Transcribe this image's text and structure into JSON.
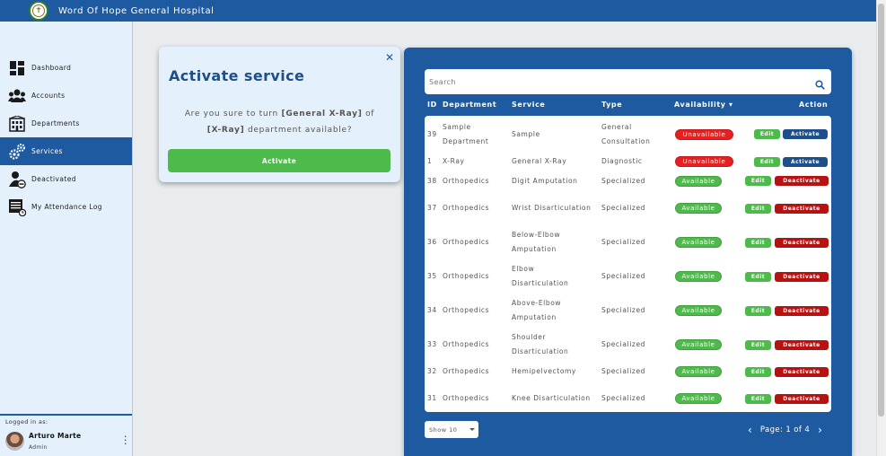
{
  "app": {
    "title": "Word Of Hope General Hospital"
  },
  "sidebar": {
    "items": [
      {
        "label": "Dashboard",
        "icon": "dashboard-icon"
      },
      {
        "label": "Accounts",
        "icon": "users-icon"
      },
      {
        "label": "Departments",
        "icon": "building-icon"
      },
      {
        "label": "Services",
        "icon": "gears-icon",
        "active": true
      },
      {
        "label": "Deactivated",
        "icon": "user-minus-icon"
      },
      {
        "label": "My Attendance Log",
        "icon": "log-icon"
      }
    ],
    "footer": {
      "logged_as": "Logged in as:",
      "name": "Arturo Marte",
      "role": "Admin"
    }
  },
  "modal": {
    "title": "Activate service",
    "msg_prefix": "Are you sure to turn ",
    "service": "[General X-Ray]",
    "msg_of": " of",
    "department": "[X-Ray]",
    "msg_suffix": " department available?",
    "button": "Activate"
  },
  "search": {
    "placeholder": "Search"
  },
  "table": {
    "headers": {
      "id": "ID",
      "department": "Department",
      "service": "Service",
      "type": "Type",
      "availability": "Availability",
      "sort_indicator": "▾",
      "action": "Action"
    },
    "rows": [
      {
        "id": "39",
        "department": "Sample Department",
        "service": "Sample",
        "type": "General Consultation",
        "availability": "Unavailable",
        "edit": "Edit",
        "action": "Activate"
      },
      {
        "id": "1",
        "department": "X-Ray",
        "service": "General X-Ray",
        "type": "Diagnostic",
        "availability": "Unavailable",
        "edit": "Edit",
        "action": "Activate"
      },
      {
        "id": "38",
        "department": "Orthopedics",
        "service": "Digit Amputation",
        "type": "Specialized",
        "availability": "Available",
        "edit": "Edit",
        "action": "Deactivate"
      },
      {
        "id": "37",
        "department": "Orthopedics",
        "service": "Wrist Disarticulation",
        "type": "Specialized",
        "availability": "Available",
        "edit": "Edit",
        "action": "Deactivate"
      },
      {
        "id": "36",
        "department": "Orthopedics",
        "service": "Below-Elbow Amputation",
        "type": "Specialized",
        "availability": "Available",
        "edit": "Edit",
        "action": "Deactivate"
      },
      {
        "id": "35",
        "department": "Orthopedics",
        "service": "Elbow Disarticulation",
        "type": "Specialized",
        "availability": "Available",
        "edit": "Edit",
        "action": "Deactivate"
      },
      {
        "id": "34",
        "department": "Orthopedics",
        "service": "Above-Elbow Amputation",
        "type": "Specialized",
        "availability": "Available",
        "edit": "Edit",
        "action": "Deactivate"
      },
      {
        "id": "33",
        "department": "Orthopedics",
        "service": "Shoulder Disarticulation",
        "type": "Specialized",
        "availability": "Available",
        "edit": "Edit",
        "action": "Deactivate"
      },
      {
        "id": "32",
        "department": "Orthopedics",
        "service": "Hemipelvectomy",
        "type": "Specialized",
        "availability": "Available",
        "edit": "Edit",
        "action": "Deactivate"
      },
      {
        "id": "31",
        "department": "Orthopedics",
        "service": "Knee Disarticulation",
        "type": "Specialized",
        "availability": "Available",
        "edit": "Edit",
        "action": "Deactivate"
      }
    ]
  },
  "pagination": {
    "show": "Show 10",
    "page_label": "Page: 1 of 4"
  },
  "colors": {
    "primary": "#1e5aa0",
    "available": "#4fba4c",
    "unavailable": "#e52020",
    "deactivate": "#b71111",
    "activate": "#1d4f8a"
  }
}
